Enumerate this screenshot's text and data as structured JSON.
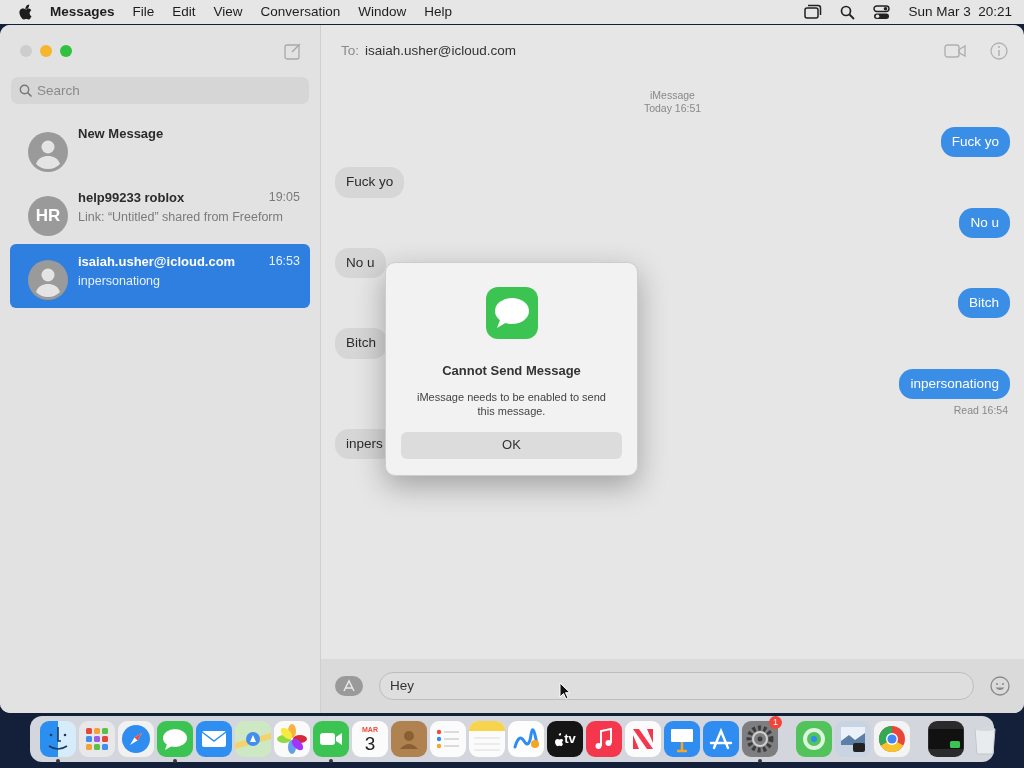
{
  "menu_bar": {
    "app": "Messages",
    "items": [
      "File",
      "Edit",
      "View",
      "Conversation",
      "Window",
      "Help"
    ],
    "clock": "Sun Mar 3  20:21"
  },
  "sidebar": {
    "search": {
      "placeholder": "Search"
    },
    "conversations": [
      {
        "name": "New Message",
        "selected": false
      },
      {
        "name": "help99233 roblox",
        "initials": "HR",
        "time": "19:05",
        "preview": "Link: “Untitled” shared from Freeform",
        "selected": false
      },
      {
        "name": "isaiah.usher@icloud.com",
        "time": "16:53",
        "preview": "inpersonationg",
        "selected": true
      }
    ]
  },
  "chat": {
    "to_label": "To:",
    "recipient": "isaiah.usher@icloud.com",
    "service": "iMessage",
    "started": "Today 16:51",
    "messages": [
      {
        "text": "Fuck yo",
        "kind": "sent"
      },
      {
        "text": "Fuck yo",
        "kind": "received"
      },
      {
        "text": "No u",
        "kind": "sent"
      },
      {
        "text": "No u",
        "kind": "received"
      },
      {
        "text": "Bitch",
        "kind": "sent"
      },
      {
        "text": "Bitch",
        "kind": "received"
      },
      {
        "text": "inpersonationg",
        "kind": "sent",
        "receipt": "Read 16:54"
      },
      {
        "text": "inpers",
        "kind": "received"
      }
    ],
    "input": {
      "value": "Hey"
    }
  },
  "dialog": {
    "title": "Cannot Send Message",
    "message": "iMessage needs to be enabled to send this message.",
    "button": "OK"
  },
  "dock": {
    "apps": [
      {
        "kind": "finder",
        "running": true
      },
      {
        "kind": "launchpad",
        "running": false
      },
      {
        "kind": "safari",
        "running": false
      },
      {
        "kind": "messages",
        "running": true
      },
      {
        "kind": "mail",
        "running": false
      },
      {
        "kind": "maps",
        "running": false
      },
      {
        "kind": "photos",
        "running": false
      },
      {
        "kind": "facetime",
        "running": true
      },
      {
        "kind": "calendar",
        "month": "MAR",
        "day": "3",
        "running": false
      },
      {
        "kind": "contacts",
        "running": false
      },
      {
        "kind": "reminders",
        "running": false
      },
      {
        "kind": "notes",
        "running": false
      },
      {
        "kind": "freeform",
        "running": false
      },
      {
        "kind": "tv",
        "label": "tv",
        "running": false
      },
      {
        "kind": "music",
        "running": false
      },
      {
        "kind": "news",
        "running": false
      },
      {
        "kind": "keynote",
        "running": false
      },
      {
        "kind": "appstore",
        "running": false
      },
      {
        "kind": "settings",
        "badge": "1",
        "running": true
      },
      {
        "kind": "separator"
      },
      {
        "kind": "findmy",
        "running": false
      },
      {
        "kind": "preview",
        "running": false
      },
      {
        "kind": "chrome",
        "running": false
      },
      {
        "kind": "separator"
      },
      {
        "kind": "screen",
        "running": false
      },
      {
        "kind": "trash",
        "running": false
      }
    ]
  }
}
